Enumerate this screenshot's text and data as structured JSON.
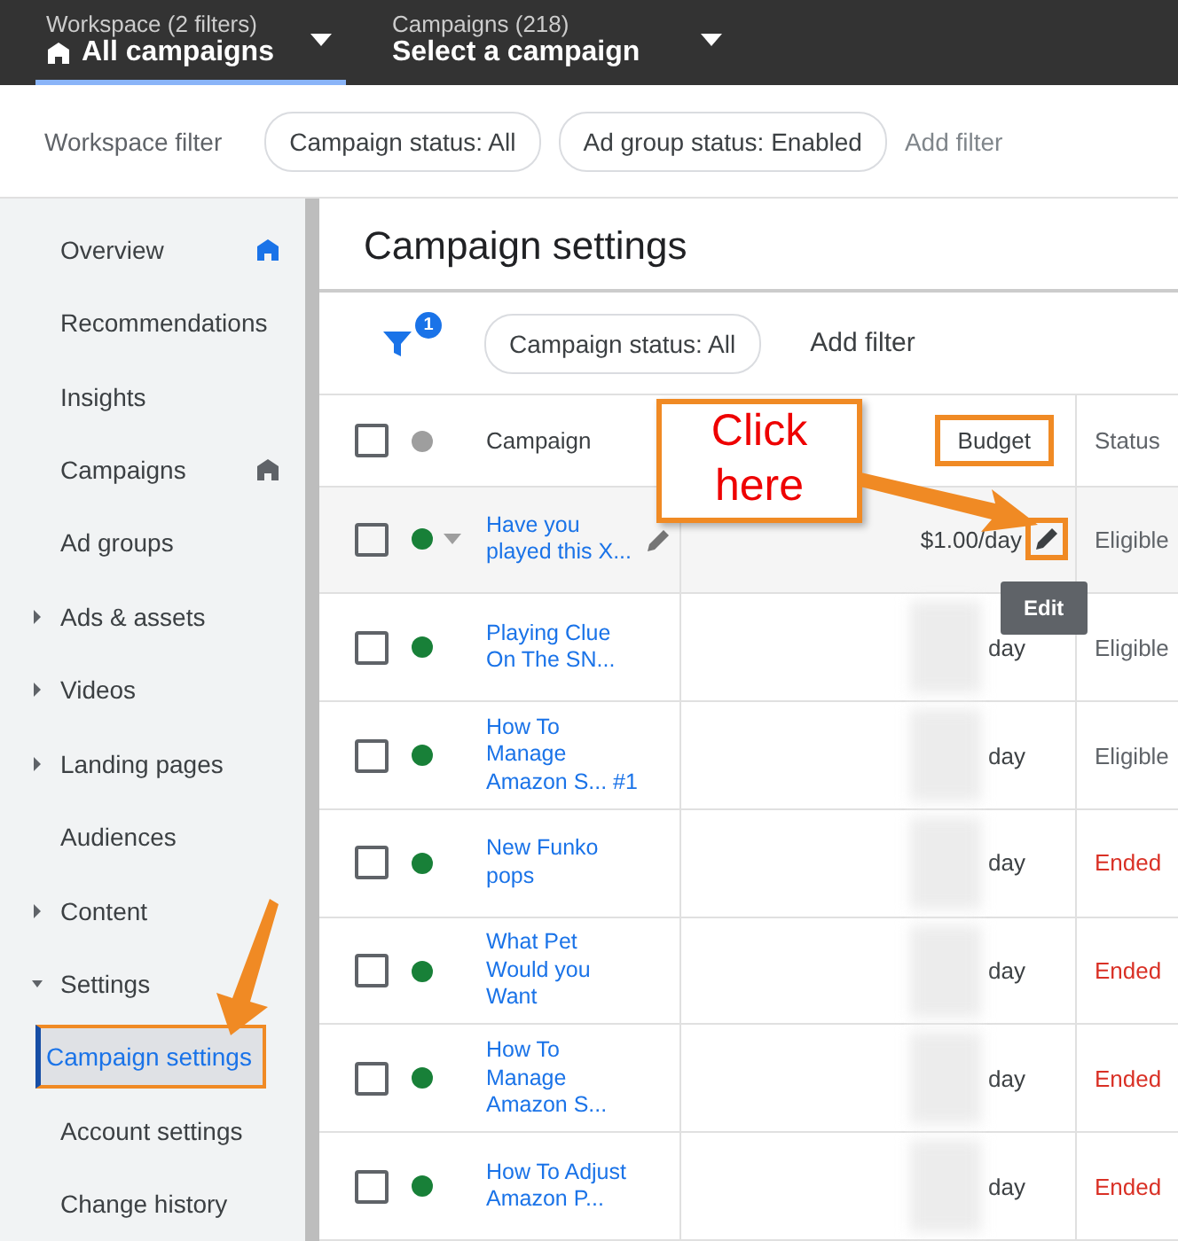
{
  "top_bar": {
    "crumbs": [
      {
        "caption": "Workspace (2 filters)",
        "title": "All campaigns",
        "home": true,
        "selected": true
      },
      {
        "caption": "Campaigns (218)",
        "title": "Select a campaign",
        "home": false,
        "selected": false
      }
    ]
  },
  "workspace_filter": {
    "label": "Workspace filter",
    "chips": [
      "Campaign status: All",
      "Ad group status: Enabled"
    ],
    "add": "Add filter"
  },
  "sidebar": {
    "items": [
      {
        "label": "Overview",
        "selected": false,
        "home_icon": true,
        "home_active": true
      },
      {
        "label": "Recommendations",
        "selected": false
      },
      {
        "label": "Insights",
        "selected": false
      },
      {
        "label": "Campaigns",
        "selected": false,
        "home_icon": true,
        "home_active": false
      },
      {
        "label": "Ad groups",
        "selected": false
      },
      {
        "label": "Ads & assets",
        "selected": false,
        "expanded": false
      },
      {
        "label": "Videos",
        "selected": false,
        "expanded": false
      },
      {
        "label": "Landing pages",
        "selected": false,
        "expanded": false
      },
      {
        "label": "Audiences",
        "selected": false
      },
      {
        "label": "Content",
        "selected": false,
        "expanded": false
      },
      {
        "label": "Settings",
        "selected": false,
        "expanded": true,
        "children": [
          {
            "label": "Campaign settings",
            "selected": true,
            "highlighted": true
          },
          {
            "label": "Account settings",
            "selected": false
          },
          {
            "label": "Change history",
            "selected": false
          }
        ]
      }
    ]
  },
  "page_title": "Campaign settings",
  "filter_bar": {
    "badge": "1",
    "chip": "Campaign status: All",
    "add": "Add filter"
  },
  "table": {
    "columns": [
      "Campaign",
      "Budget",
      "Status"
    ],
    "all_checked": false,
    "rows": [
      {
        "campaign": "Have you played this X...",
        "budget": "$1.00/day",
        "masked": false,
        "status": "Eligible",
        "ended": false,
        "checked": false,
        "hovered": true
      },
      {
        "campaign": "Playing Clue On The SN...",
        "budget": "day",
        "masked": true,
        "status": "Eligible",
        "ended": false,
        "checked": false,
        "hovered": false
      },
      {
        "campaign": "How To Manage Amazon S... #1",
        "budget": "day",
        "masked": true,
        "status": "Eligible",
        "ended": false,
        "checked": false,
        "hovered": false
      },
      {
        "campaign": "New Funko pops",
        "budget": "day",
        "masked": true,
        "status": "Ended",
        "ended": true,
        "checked": false,
        "hovered": false
      },
      {
        "campaign": "What Pet Would you Want",
        "budget": "day",
        "masked": true,
        "status": "Ended",
        "ended": true,
        "checked": false,
        "hovered": false
      },
      {
        "campaign": "How To Manage Amazon S...",
        "budget": "day",
        "masked": true,
        "status": "Ended",
        "ended": true,
        "checked": false,
        "hovered": false
      },
      {
        "campaign": "How To Adjust Amazon P...",
        "budget": "day",
        "masked": true,
        "status": "Ended",
        "ended": true,
        "checked": false,
        "hovered": false
      }
    ]
  },
  "tooltip": "Edit",
  "callout": {
    "lines": [
      "Click",
      "here"
    ]
  }
}
